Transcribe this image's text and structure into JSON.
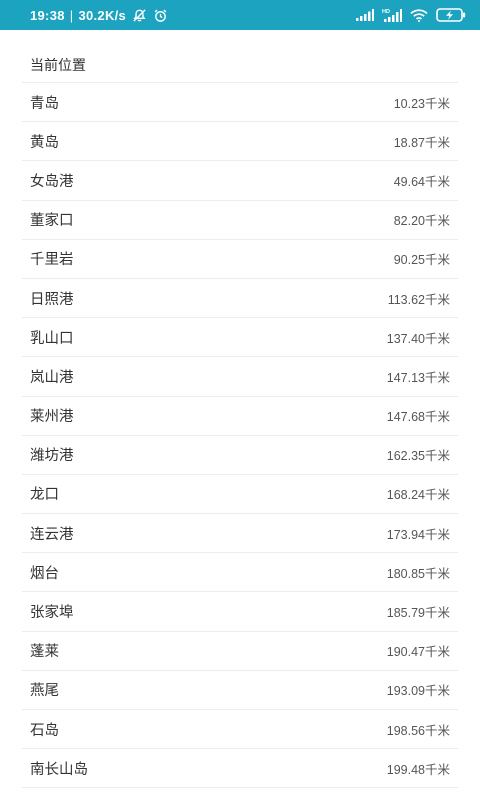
{
  "status_bar": {
    "time": "19:38",
    "separator": "|",
    "speed": "30.2K/s",
    "network_label": "HD"
  },
  "header": {
    "label": "当前位置"
  },
  "ports": [
    {
      "name": "青岛",
      "distance": "10.23千米"
    },
    {
      "name": "黄岛",
      "distance": "18.87千米"
    },
    {
      "name": "女岛港",
      "distance": "49.64千米"
    },
    {
      "name": "董家口",
      "distance": "82.20千米"
    },
    {
      "name": "千里岩",
      "distance": "90.25千米"
    },
    {
      "name": "日照港",
      "distance": "113.62千米"
    },
    {
      "name": "乳山口",
      "distance": "137.40千米"
    },
    {
      "name": "岚山港",
      "distance": "147.13千米"
    },
    {
      "name": "莱州港",
      "distance": "147.68千米"
    },
    {
      "name": "潍坊港",
      "distance": "162.35千米"
    },
    {
      "name": "龙口",
      "distance": "168.24千米"
    },
    {
      "name": "连云港",
      "distance": "173.94千米"
    },
    {
      "name": "烟台",
      "distance": "180.85千米"
    },
    {
      "name": "张家埠",
      "distance": "185.79千米"
    },
    {
      "name": "蓬莱",
      "distance": "190.47千米"
    },
    {
      "name": "燕尾",
      "distance": "193.09千米"
    },
    {
      "name": "石岛",
      "distance": "198.56千米"
    },
    {
      "name": "南长山岛",
      "distance": "199.48千米"
    }
  ]
}
